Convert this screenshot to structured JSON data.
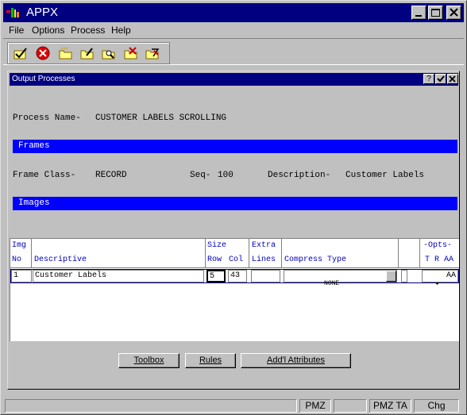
{
  "app": {
    "title": "APPX"
  },
  "menu": {
    "items": [
      "File",
      "Options",
      "Process",
      "Help"
    ]
  },
  "toolbar": {
    "icons": [
      "check-folder-icon",
      "cancel-icon",
      "open-folder-icon",
      "edit-folder-icon",
      "search-folder-icon",
      "delete-folder-icon",
      "run-folder-icon"
    ]
  },
  "child": {
    "title": "Output Processes",
    "help_label": "?"
  },
  "process": {
    "name_label": "Process Name-",
    "name_value": "CUSTOMER LABELS SCROLLING"
  },
  "frames": {
    "section_label": "Frames",
    "class_label": "Frame Class-",
    "class_value": "RECORD",
    "seq_label": "Seq-",
    "seq_value": "100",
    "desc_label": "Description-",
    "desc_value": "Customer Labels"
  },
  "images": {
    "section_label": "Images",
    "headers": {
      "img": "Img",
      "no": "No",
      "descriptive": "Descriptive",
      "size": "Size",
      "row": "Row",
      "col": "Col",
      "extra": "Extra",
      "lines": "Lines",
      "compress_type": "Compress Type",
      "opts": "-Opts-",
      "t": "T",
      "r": "R",
      "aa": "AA"
    },
    "rows": [
      {
        "no": "1",
        "descriptive": "Customer Labels",
        "row": "5",
        "col": "43",
        "extra": "",
        "compress_type": "NONE",
        "aa": "AA"
      }
    ]
  },
  "buttons": {
    "toolbox": "Toolbox",
    "rules": "Rules",
    "addl_attributes": "Add'l Attributes"
  },
  "status": {
    "panels": [
      "",
      "PMZ",
      "",
      "PMZ TA",
      "Chg"
    ]
  }
}
